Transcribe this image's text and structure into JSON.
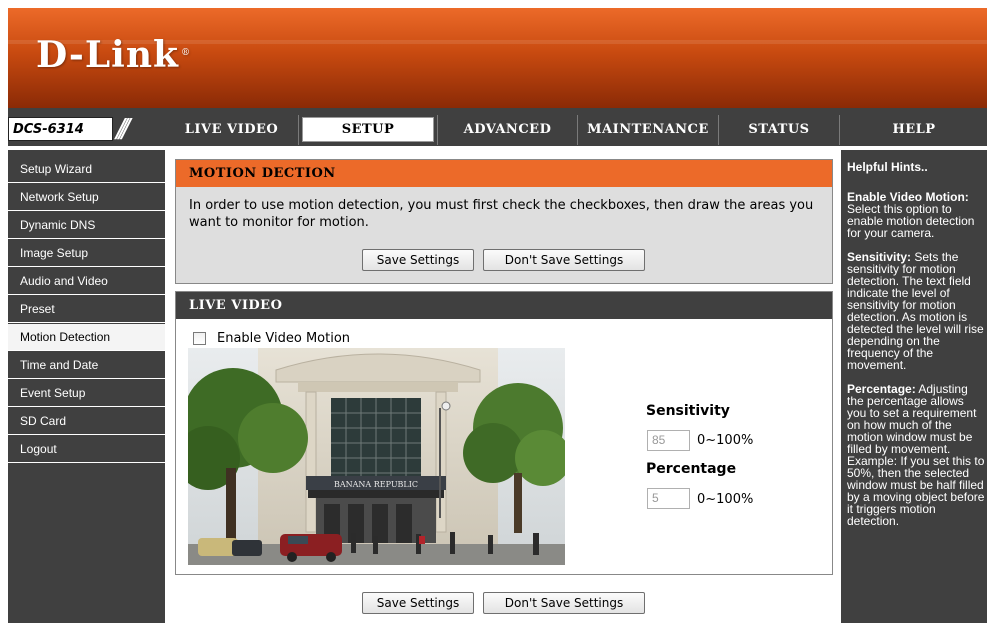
{
  "brand": {
    "logo": "D-Link",
    "model": "DCS-6314"
  },
  "nav": {
    "tabs": [
      {
        "label": "LIVE VIDEO"
      },
      {
        "label": "SETUP"
      },
      {
        "label": "ADVANCED"
      },
      {
        "label": "MAINTENANCE"
      },
      {
        "label": "STATUS"
      },
      {
        "label": "HELP"
      }
    ],
    "active_tab": "SETUP"
  },
  "sidebar": {
    "items": [
      {
        "label": "Setup Wizard"
      },
      {
        "label": "Network Setup"
      },
      {
        "label": "Dynamic DNS"
      },
      {
        "label": "Image Setup"
      },
      {
        "label": "Audio and Video"
      },
      {
        "label": "Preset"
      },
      {
        "label": "Motion Detection"
      },
      {
        "label": "Time and Date"
      },
      {
        "label": "Event Setup"
      },
      {
        "label": "SD Card"
      },
      {
        "label": "Logout"
      }
    ],
    "active_item": "Motion Detection"
  },
  "motion": {
    "title": "MOTION DECTION",
    "description": "In order to use motion detection, you must first check the checkboxes, then draw the areas you want to monitor for motion.",
    "save_label": "Save Settings",
    "dont_save_label": "Don't Save Settings"
  },
  "live": {
    "title": "LIVE VIDEO",
    "enable_label": "Enable Video Motion",
    "enable_checked": false,
    "video_sign_text": "BANANA REPUBLIC",
    "sensitivity_label": "Sensitivity",
    "sensitivity_value": "85",
    "sensitivity_range": "0~100%",
    "percentage_label": "Percentage",
    "percentage_value": "5",
    "percentage_range": "0~100%"
  },
  "footer_buttons": {
    "save_label": "Save Settings",
    "dont_save_label": "Don't Save Settings"
  },
  "hints": {
    "title": "Helpful Hints..",
    "enable_title": "Enable Video Motion:",
    "enable_text": "Select this option to enable motion detection for your camera.",
    "sensitivity_title": "Sensitivity:",
    "sensitivity_text": "Sets the sensitivity for motion detection. The text field indicate the level of sensitivity for motion detection. As motion is detected the level will rise depending on the frequency of the movement.",
    "percentage_title": "Percentage:",
    "percentage_text": "Adjusting the percentage allows you to set a requirement on how much of the motion window must be filled by movement. Example: If you set this to 50%, then the selected window must be half filled by a moving object before it triggers motion detection."
  },
  "colors": {
    "accent": "#ec6a29",
    "dark": "#404040",
    "panel": "#dedede"
  }
}
